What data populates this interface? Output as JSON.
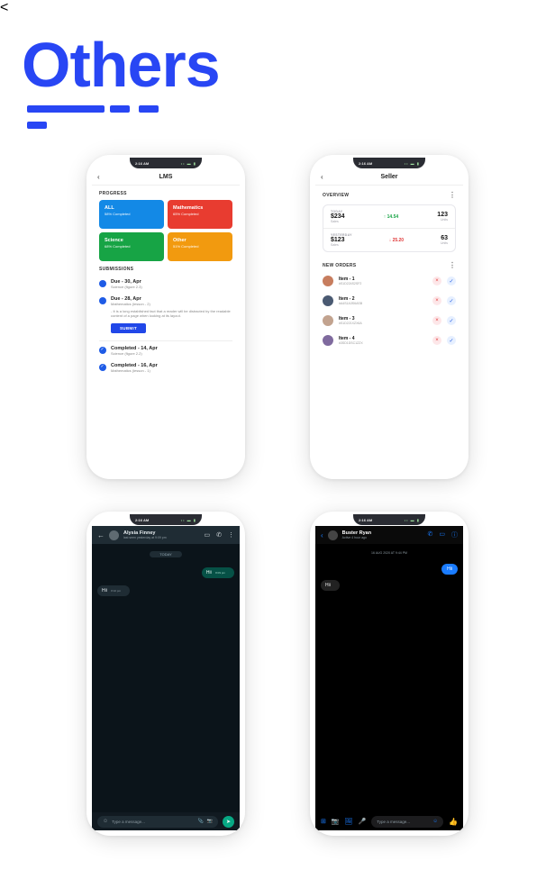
{
  "heading": "Others",
  "statusbar": {
    "time": "2:16 AM",
    "signal": "•• ▬ ▮"
  },
  "lms": {
    "title": "LMS",
    "progress_label": "PROGRESS",
    "cards": [
      {
        "name": "ALL",
        "sub": "58% Completed"
      },
      {
        "name": "Mathematics",
        "sub": "65% Completed"
      },
      {
        "name": "Science",
        "sub": "68% Completed"
      },
      {
        "name": "Other",
        "sub": "51% Completed"
      }
    ],
    "submissions_label": "SUBMISSIONS",
    "submit_label": "SUBMIT",
    "submissions": [
      {
        "title": "Due - 30, Apr",
        "meta": "Science (figure 2.3)"
      },
      {
        "title": "Due - 28, Apr",
        "meta": "Mathematics (lesson - 2)",
        "desc": "- It is a long established fact that a reader will be distracted by the readable content of a page when looking at its layout."
      },
      {
        "title": "Completed - 14, Apr",
        "meta": "Science (figure 2.2)"
      },
      {
        "title": "Completed - 16, Apr",
        "meta": "Mathematics (lesson - 1)"
      }
    ]
  },
  "seller": {
    "title": "Seller",
    "overview_label": "OVERVIEW",
    "neworders_label": "NEW ORDERS",
    "today_label": "TODAY",
    "yesterday_label": "YESTERDAY",
    "sales_label": "Sales",
    "units_label": "Units",
    "today": {
      "sales": "$234",
      "delta": "↑ 14.54",
      "units": "123"
    },
    "yesterday": {
      "sales": "$123",
      "delta": "↓ 25.20",
      "units": "63"
    },
    "orders": [
      {
        "name": "Item - 1",
        "hash": "#S1D224S2SF2"
      },
      {
        "name": "Item - 2",
        "hash": "#A4S1A3S6ASB"
      },
      {
        "name": "Item - 3",
        "hash": "#S1D221XZX6A"
      },
      {
        "name": "Item - 4",
        "hash": "#3SD1DSC1ZZX"
      }
    ]
  },
  "wa": {
    "name": "Alysia Finney",
    "lastseen": "last seen yesterday at 9:09 pm",
    "today_chip": "TODAY",
    "msg_out": "Hii",
    "msg_out_time": "8:09 pm",
    "msg_in": "Hii",
    "msg_in_time": "8:10 pm",
    "compose_placeholder": "Type a message..."
  },
  "fb": {
    "name": "Buster Ryan",
    "active": "Active 4 hour ago",
    "timestamp": "16 AUG 2020 AT 9:44 PM",
    "msg_out": "Hii",
    "msg_in": "Hii",
    "compose_placeholder": "Type a message..."
  }
}
